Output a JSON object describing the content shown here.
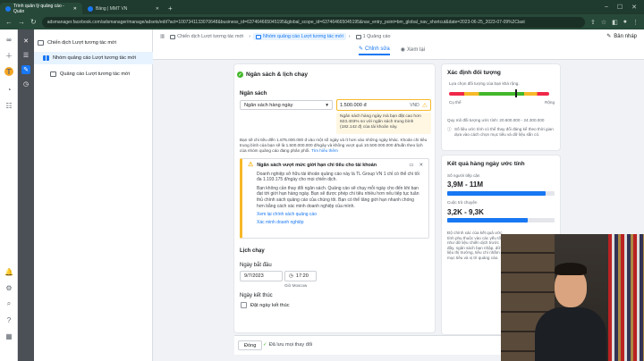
{
  "browser": {
    "tabs": [
      {
        "label": "Trình quản lý quảng cáo - Quản",
        "active": true
      },
      {
        "label": "Bảng | MMT VN",
        "active": false
      }
    ],
    "url": "adsmanager.facebook.com/adsmanager/manage/adsets/edit?act=1007341133070648&business_id=637464665045195&global_scope_id=637464665045195&nav_entry_point=bm_global_nav_shortcut&date=2023-06-25_2023-07-09%2Clast"
  },
  "tree": {
    "items": [
      {
        "label": "Chiến dịch Lượt tương tác mới",
        "level": 0
      },
      {
        "label": "Nhóm quảng cáo Lượt tương tác mới",
        "level": 1
      },
      {
        "label": "Quảng cáo Lượt tương tác mới",
        "level": 2
      }
    ]
  },
  "header": {
    "breadcrumbs": [
      "Chiến dịch Lượt tương tác mới",
      "Nhóm quảng cáo Lượt tương tác mới",
      "1 Quảng cáo"
    ],
    "draft_label": "Bản nháp",
    "modes": [
      "Chỉnh sửa",
      "Xem lại"
    ]
  },
  "budget": {
    "section_title": "Ngân sách & lịch chạy",
    "budget_label": "Ngân sách",
    "budget_type": "Ngân sách hàng ngày",
    "amount": "1.500.000 đ",
    "currency": "VND",
    "tip": "Ngân sách hàng ngày mà bạn đặt cao hơn 823.403% so với ngân sách trung bình (182.142 đ) của tài khoản này.",
    "paragraph": "Bạn sẽ chi tiêu đến 1.875.000.000 đ vào một số ngày và ít hơn vào những ngày khác. Khoản chi tiêu trung bình của bạn sẽ là 1.500.000.000 đ/ngày và không vượt quá 10.500.000.000 đ/tuần theo lịch của nhóm quảng cáo đang phân phối.",
    "paragraph_link": "Tìm hiểu thêm",
    "alert_title": "Ngân sách vượt mức giới hạn chi tiêu cho tài khoản",
    "alert_p1": "Doanh nghiệp sở hữu tài khoản quảng cáo này là TL Group VN 1 chỉ có thể chi tối đa 1.193.175 đ/ngày cho mọi chiến dịch.",
    "alert_p2": "Bạn không cần thay đổi ngân sách. Quảng cáo sẽ chạy mỗi ngày cho đến khi bạn đạt tới giới hạn hàng ngày. Bạn sẽ được phép chi tiêu nhiều hơn nếu tiếp tục tuân thủ chính sách quảng cáo của chúng tôi. Bạn có thể tăng giới hạn nhanh chóng hơn bằng cách xác minh doanh nghiệp của mình.",
    "alert_link1": "Xem lại chính sách quảng cáo",
    "alert_link2": "Xác minh doanh nghiệp",
    "schedule_label": "Lịch chạy",
    "start_label": "Ngày bắt đầu",
    "start_date": "9/7/2023",
    "start_time": "17:20",
    "tz": "Giờ Moscow",
    "end_label": "Ngày kết thúc",
    "end_checkbox": "Đặt ngày kết thúc"
  },
  "footer": {
    "close": "Đóng",
    "saved": "Đã lưu mọi thay đổi"
  },
  "audience": {
    "title": "Xác định đối tượng",
    "subtitle": "Lựa chọn đối tượng của bạn khá rộng.",
    "left": "Cụ thể",
    "right": "Rộng",
    "size_text": "Quy mô đối tượng ước tính: 20.600.000 - 24.300.000",
    "note": "Số liệu ước tính có thể thay đổi đáng kể theo thời gian dựa vào cách chọn mục tiêu và dữ liệu sẵn có."
  },
  "results": {
    "title": "Kết quả hàng ngày ước tính",
    "reach_label": "Số người tiếp cận",
    "reach_value": "3,9M - 11M",
    "reach_fill": 0.92,
    "clicks_label": "Cuộc trò chuyện",
    "clicks_value": "3,2K - 9,3K",
    "clicks_fill": 0.75,
    "note": "Độ chính xác của kết quả ước tính phụ thuộc vào các yếu tố như dữ liệu chiến dịch trước đây, ngân sách bạn nhập, dữ liệu thị trường, tiêu chí nhắm mục tiêu và vị trí quảng cáo."
  }
}
